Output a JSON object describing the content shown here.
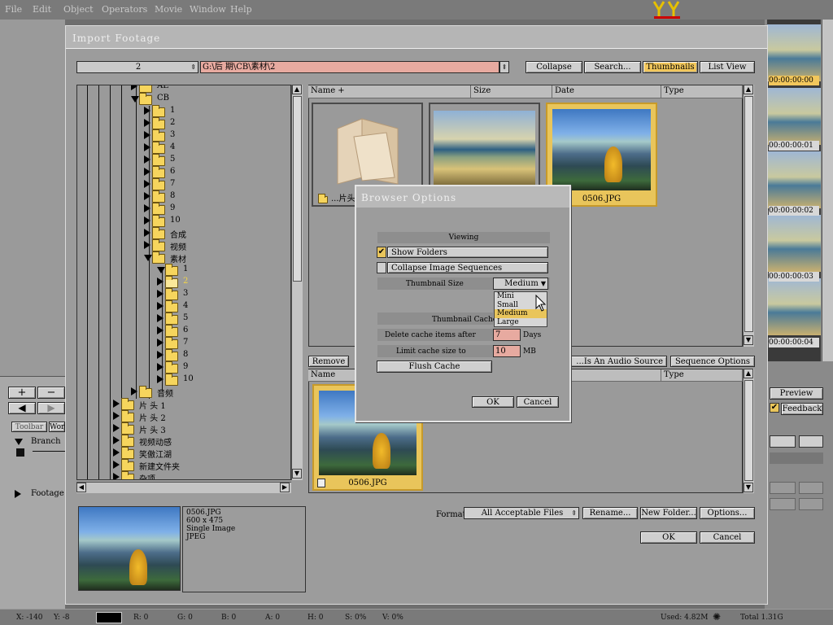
{
  "menubar": {
    "items": [
      "File",
      "Edit",
      "Object",
      "Operators",
      "Movie",
      "Window",
      "Help"
    ]
  },
  "dialog": {
    "title": "Import Footage",
    "path_number": "2",
    "path": "G:\\后 期\\CB\\素材\\2",
    "buttons": {
      "collapse": "Collapse",
      "search": "Search...",
      "thumbnails": "Thumbnails",
      "list_view": "List View"
    },
    "columns": [
      "Name +",
      "Size",
      "Date",
      "Type"
    ],
    "thumbs": [
      {
        "caption": "...片头",
        "kind": "folder"
      },
      {
        "caption": "",
        "kind": "image"
      },
      {
        "caption": "0506.JPG",
        "kind": "image",
        "selected": true
      }
    ],
    "tree": {
      "top_items": [
        "AE",
        "CB"
      ],
      "cb_children": [
        "1",
        "2",
        "3",
        "4",
        "5",
        "6",
        "7",
        "8",
        "9",
        "10",
        "合成",
        "视频",
        "素材"
      ],
      "sucai_children": [
        "1",
        "2",
        "3",
        "4",
        "5",
        "6",
        "7",
        "8",
        "9",
        "10"
      ],
      "after": [
        "音频"
      ],
      "root_items": [
        "片 头 1",
        "片 头 2",
        "片 头 3",
        "视频动感",
        "笑傲江湖",
        "新建文件夹",
        "杂项"
      ]
    },
    "lower": {
      "remove": "Remove",
      "audio_source": "...Is An Audio Source",
      "sequence_options": "Sequence Options",
      "columns": [
        "Name",
        "Type"
      ],
      "item_caption": "0506.JPG"
    },
    "info": {
      "filename": "0506.JPG",
      "dimensions": "600 x 475",
      "kind": "Single Image",
      "format": "JPEG"
    },
    "format_label": "Format",
    "format_value": "All Acceptable Files",
    "rename": "Rename...",
    "new_folder": "New Folder...",
    "options": "Options...",
    "ok": "OK",
    "cancel": "Cancel"
  },
  "browser_options": {
    "title": "Browser Options",
    "viewing": "Viewing",
    "show_folders": "Show Folders",
    "show_folders_checked": true,
    "collapse_sequences": "Collapse Image Sequences",
    "thumbnail_size_label": "Thumbnail Size",
    "thumbnail_size_value": "Medium",
    "size_options": [
      "Mini",
      "Small",
      "Medium",
      "Large"
    ],
    "cache_section": "Thumbnail Cache",
    "delete_after_label": "Delete cache items after",
    "delete_after_value": "7",
    "delete_after_unit": "Days",
    "limit_label": "Limit cache size to",
    "limit_value": "10",
    "limit_unit": "MB",
    "flush": "Flush Cache",
    "ok": "OK",
    "cancel": "Cancel"
  },
  "right_panel": {
    "timecodes": [
      "00:00:00:00",
      "00:00:00:01",
      "00:00:00:02",
      "00:00:00:03",
      "00:00:00:04"
    ],
    "preview": "Preview",
    "feedback": "Feedback"
  },
  "left_panel": {
    "plus": "+",
    "minus": "−",
    "tabs": [
      "Toolbar",
      "Wor"
    ],
    "branch": "Branch",
    "footage": "Footage"
  },
  "statusbar": {
    "x": "X: -140",
    "y": "Y: -8",
    "r": "R: 0",
    "g": "G: 0",
    "b": "B: 0",
    "a": "A: 0",
    "h": "H: 0",
    "s": "S: 0%",
    "v": "V: 0%",
    "used": "Used: 4.82M",
    "total": "Total 1.31G"
  }
}
